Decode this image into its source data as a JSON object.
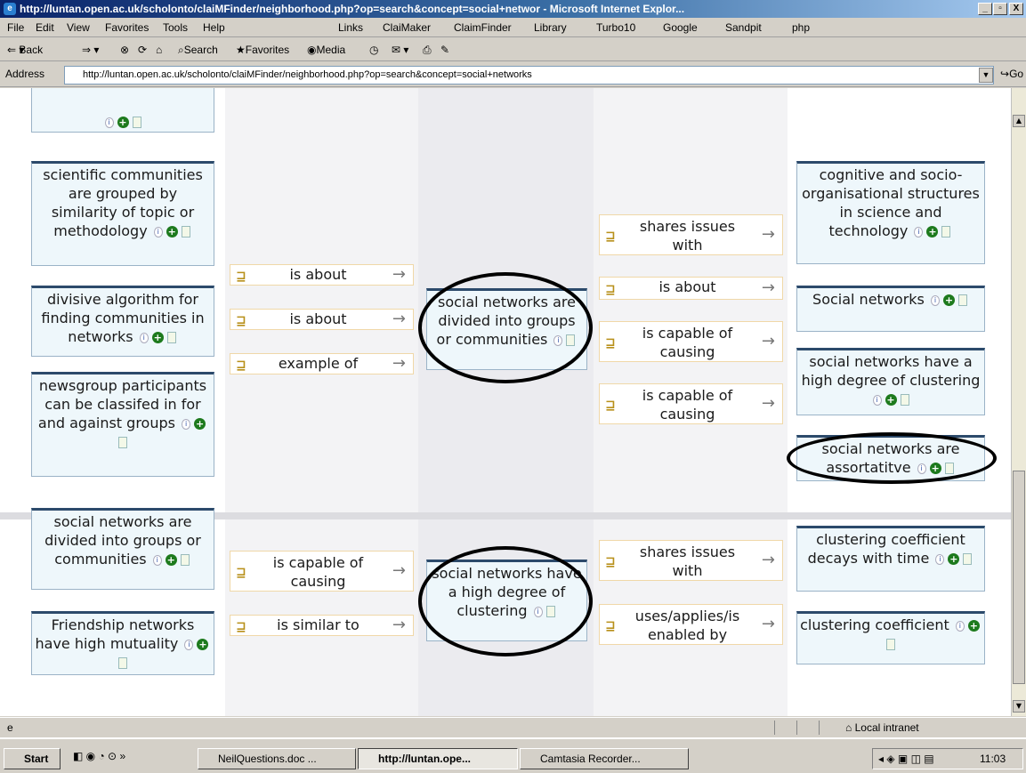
{
  "window": {
    "title": "http://luntan.open.ac.uk/scholonto/claiMFinder/neighborhood.php?op=search&concept=social+networ - Microsoft Internet Explor...",
    "controls": [
      "_",
      "▫",
      "X"
    ]
  },
  "menubar": {
    "items": [
      "File",
      "Edit",
      "View",
      "Favorites",
      "Tools",
      "Help"
    ],
    "links_label": "Links",
    "links": [
      "ClaiMaker",
      "ClaimFinder",
      "Library",
      "Turbo10",
      "Google",
      "Sandpit",
      "php"
    ]
  },
  "toolbar": {
    "back": "Back",
    "search": "Search",
    "favorites": "Favorites",
    "media": "Media"
  },
  "address": {
    "label": "Address",
    "url": "http://luntan.open.ac.uk/scholonto/claiMFinder/neighborhood.php?op=search&concept=social+networks",
    "go": "Go"
  },
  "graph": {
    "block1": {
      "left_nodes": [
        "scientific communities are grouped by similarity of topic or methodology",
        "divisive algorithm for finding communities in networks",
        "newsgroup participants can be classifed in for and against groups"
      ],
      "left_links": [
        "is about",
        "is about",
        "example of"
      ],
      "center": "social networks are divided into groups or communities",
      "right_links": [
        "shares issues with",
        "is about",
        "is capable of causing",
        "is capable of causing"
      ],
      "right_nodes": [
        "cognitive and socio-organisational structures in science and technology",
        "Social networks",
        "social networks have a high degree of clustering",
        "social networks are assortatitve"
      ]
    },
    "block2": {
      "left_nodes": [
        "social networks are divided into groups or communities",
        "Friendship networks have high mutuality"
      ],
      "left_links": [
        "is capable of causing",
        "is similar to"
      ],
      "center": "social networks have a high degree of clustering",
      "right_links": [
        "shares issues with",
        "uses/applies/is enabled by"
      ],
      "right_nodes": [
        "clustering coefficient decays with time",
        "clustering coefficient"
      ]
    }
  },
  "statusbar": {
    "zone": "Local intranet"
  },
  "taskbar": {
    "start": "Start",
    "tasks": [
      "NeilQuestions.doc ...",
      "http://luntan.ope...",
      "Camtasia Recorder..."
    ],
    "clock": "11:03"
  },
  "colors": {
    "title_start": "#0a246a",
    "node_border": "#2c4a6b",
    "node_bg": "#eef7fb",
    "link_border": "#f0d8a8"
  }
}
